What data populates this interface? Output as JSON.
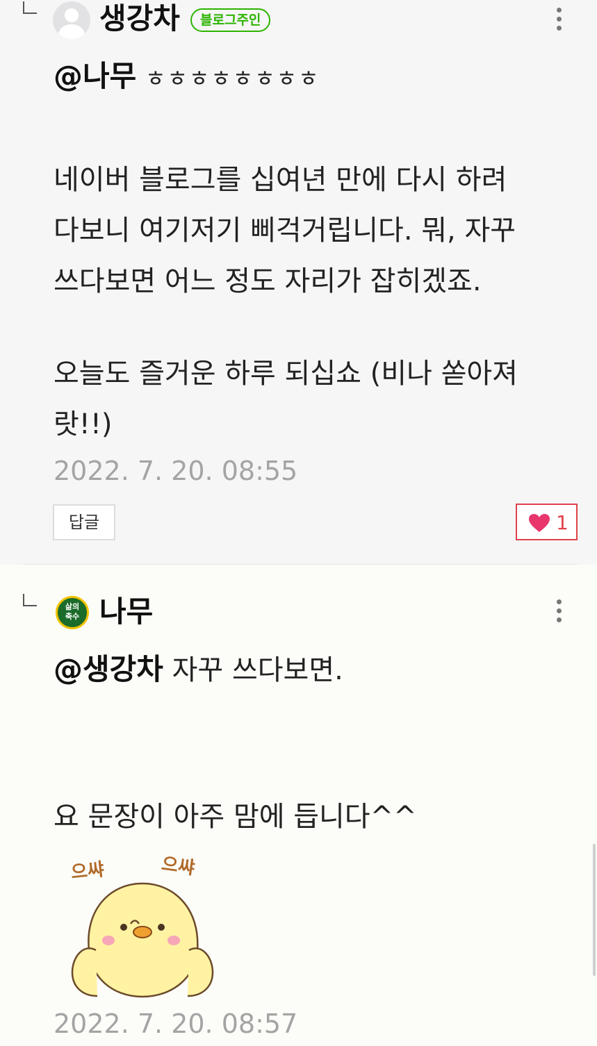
{
  "comments": [
    {
      "author": "생강차",
      "badge": "블로그주인",
      "mention": "@나무",
      "text_after_mention": "ㅎㅎㅎㅎㅎㅎㅎㅎ",
      "paragraph1_line1": "네이버 블로그를 십여년 만에 다시 하려",
      "paragraph1_line2": "다보니 여기저기 삐걱거립니다. 뭐, 자꾸",
      "paragraph1_line3": "쓰다보면 어느 정도 자리가 잡히겠죠.",
      "paragraph2_line1": "오늘도 즐거운 하루 되십쇼 (비나 쏟아져",
      "paragraph2_line2": "랏!!)",
      "timestamp": "2022. 7. 20. 08:55",
      "reply_label": "답글",
      "like_count": "1"
    },
    {
      "author": "나무",
      "avatar_line1": "삶의",
      "avatar_line2": "축수",
      "mention": "@생강차",
      "text_after_mention": " 자꾸 쓰다보면.",
      "paragraph2": "요 문장이 아주 맘에 듭니다^^",
      "sticker_text_left": "으쌰",
      "sticker_text_right": "으쌰",
      "timestamp": "2022. 7. 20. 08:57"
    }
  ],
  "colors": {
    "badge_green": "#2db400",
    "like_red": "#e0424a",
    "timestamp_gray": "#a4a4a4"
  },
  "icons": [
    "reply-indent-icon",
    "more-options-icon",
    "heart-icon",
    "default-avatar-icon"
  ]
}
